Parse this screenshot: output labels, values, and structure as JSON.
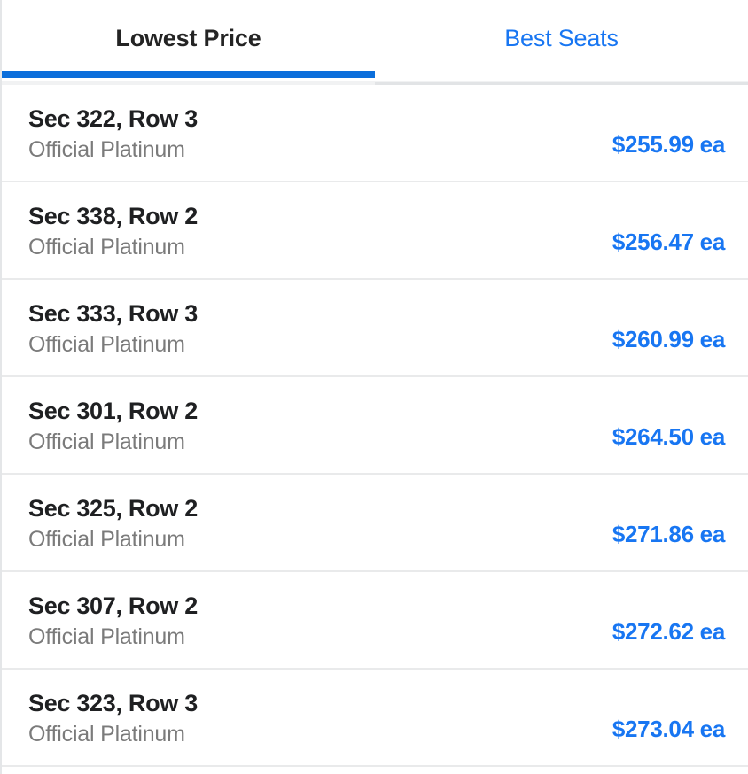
{
  "tabs": [
    {
      "label": "Lowest Price",
      "active": true
    },
    {
      "label": "Best Seats",
      "active": false
    }
  ],
  "colors": {
    "accent_underline": "#0b6edb",
    "link_blue": "#1876f2",
    "title_dark": "#1f2022",
    "subtitle_gray": "#7b7b7b",
    "divider": "#e9eaeb"
  },
  "tickets": [
    {
      "title": "Sec 322, Row 3",
      "subtitle": "Official Platinum",
      "price": "$255.99 ea"
    },
    {
      "title": "Sec 338, Row 2",
      "subtitle": "Official Platinum",
      "price": "$256.47 ea"
    },
    {
      "title": "Sec 333, Row 3",
      "subtitle": "Official Platinum",
      "price": "$260.99 ea"
    },
    {
      "title": "Sec 301, Row 2",
      "subtitle": "Official Platinum",
      "price": "$264.50 ea"
    },
    {
      "title": "Sec 325, Row 2",
      "subtitle": "Official Platinum",
      "price": "$271.86 ea"
    },
    {
      "title": "Sec 307, Row 2",
      "subtitle": "Official Platinum",
      "price": "$272.62 ea"
    },
    {
      "title": "Sec 323, Row 3",
      "subtitle": "Official Platinum",
      "price": "$273.04 ea"
    }
  ]
}
